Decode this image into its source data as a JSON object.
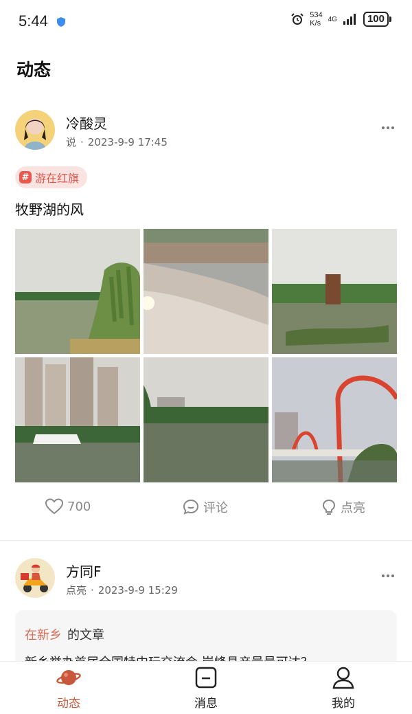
{
  "status_bar": {
    "time": "5:44",
    "net_speed_value": "534",
    "net_speed_unit": "K/s",
    "network": "4G",
    "battery": "100"
  },
  "page": {
    "title": "动态"
  },
  "posts": [
    {
      "author": "冷酸灵",
      "action": "说",
      "separator": "·",
      "datetime": "2023-9-9 17:45",
      "topic_tag": "游在红旗",
      "tag_symbol": "#",
      "text": "牧野湖的风",
      "photo_count": 6,
      "likes": "700",
      "comment_label": "评论",
      "light_label": "点亮"
    },
    {
      "author": "方同F",
      "action": "点亮",
      "separator": "·",
      "datetime": "2023-9-9 15:29",
      "article": {
        "source": "在新乡",
        "source_suffix": "的文章",
        "title": "新乡举办首届全国特中玩交流会 岸峰县产量最可达？"
      }
    }
  ],
  "tab_bar": {
    "items": [
      {
        "label": "动态",
        "icon": "planet-icon",
        "active": true
      },
      {
        "label": "消息",
        "icon": "message-icon",
        "active": false
      },
      {
        "label": "我的",
        "icon": "person-icon",
        "active": false
      }
    ],
    "accent_color": "#c9573c"
  }
}
